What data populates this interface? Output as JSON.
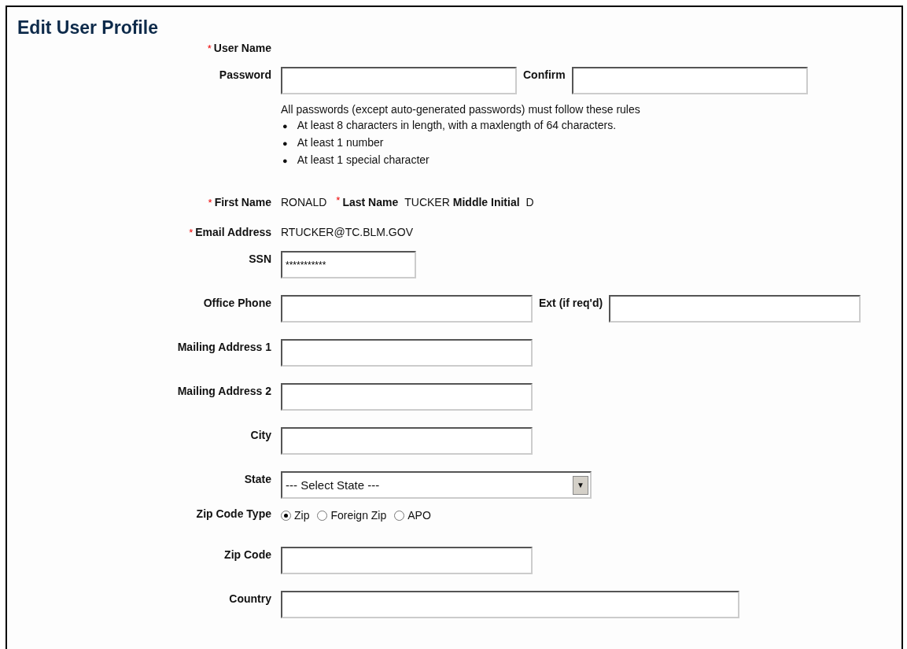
{
  "title": "Edit User Profile",
  "rows": [
    {
      "kind": "text",
      "mark": "*",
      "label": "User Name"
    },
    {
      "kind": "pair",
      "label": "Password",
      "value": "",
      "label2": "Confirm",
      "value2": ""
    },
    {
      "kind": "rules",
      "intro": "All passwords (except auto-generated passwords) must follow these rules",
      "items": [
        {
          "bullet": "●",
          "text": "At least 8 characters in length, with a maxlength of 64 characters."
        },
        {
          "bullet": "●",
          "text": "At least 1 number"
        },
        {
          "bullet": "●",
          "text": "At least 1 special character"
        }
      ]
    },
    {
      "kind": "names",
      "parts": [
        {
          "mark": "*",
          "label": "First Name",
          "value": "RONALD"
        },
        {
          "mark": "*",
          "label": "Last Name",
          "value": "TUCKER"
        },
        {
          "label": "Middle Initial",
          "value": "D"
        }
      ]
    },
    {
      "kind": "text",
      "mark": "*",
      "label": "Email Address",
      "value": "RTUCKER@TC.BLM.GOV"
    },
    {
      "kind": "input",
      "label": "SSN",
      "value": "***********"
    },
    {
      "kind": "pair",
      "label": "Office Phone",
      "value": "",
      "label2": "Ext (if req'd)",
      "value2": ""
    },
    {
      "kind": "input",
      "label": "Mailing Address 1",
      "value": ""
    },
    {
      "kind": "input",
      "label": "Mailing Address 2",
      "value": ""
    },
    {
      "kind": "input",
      "label": "City",
      "value": ""
    },
    {
      "kind": "select",
      "label": "State",
      "value": "--- Select State ---",
      "arrow": "▼"
    },
    {
      "kind": "radio",
      "label": "Zip Code Type",
      "options": [
        {
          "label": "Zip",
          "selected": true
        },
        {
          "label": "Foreign Zip",
          "selected": false
        },
        {
          "label": "APO",
          "selected": false
        }
      ]
    },
    {
      "kind": "input",
      "label": "Zip Code",
      "value": ""
    },
    {
      "kind": "input",
      "label": "Country",
      "value": ""
    }
  ]
}
